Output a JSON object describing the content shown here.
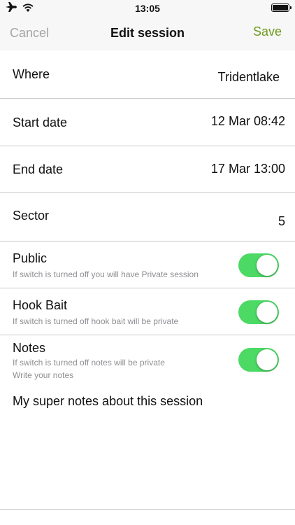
{
  "status_bar": {
    "time": "13:05",
    "icons": [
      "airplane-icon",
      "wifi-icon",
      "battery-icon"
    ]
  },
  "nav": {
    "cancel_label": "Cancel",
    "title": "Edit session",
    "save_label": "Save"
  },
  "fields": {
    "where": {
      "label": "Where",
      "value": "Tridentlake"
    },
    "start_date": {
      "label": "Start date",
      "value": "12 Mar 08:42"
    },
    "end_date": {
      "label": "End date",
      "value": "17 Mar 13:00"
    },
    "sector": {
      "label": "Sector",
      "value": "5"
    }
  },
  "toggles": {
    "public": {
      "label": "Public",
      "hint": "If switch is turned off you will have Private session",
      "on": true
    },
    "hook_bait": {
      "label": "Hook Bait",
      "hint": "If switch is turned off hook bait will be private",
      "on": true
    },
    "notes": {
      "label": "Notes",
      "hint": "If switch is turned off notes will be private",
      "hint2": "Write your notes",
      "on": true
    }
  },
  "notes_text": "My super notes about this session",
  "colors": {
    "accent_green": "#4cd964",
    "save_green": "#6e9a1f",
    "cancel_gray": "#a5a5a5",
    "separator": "#c8c7cc",
    "bar_background": "#f7f7f7"
  }
}
